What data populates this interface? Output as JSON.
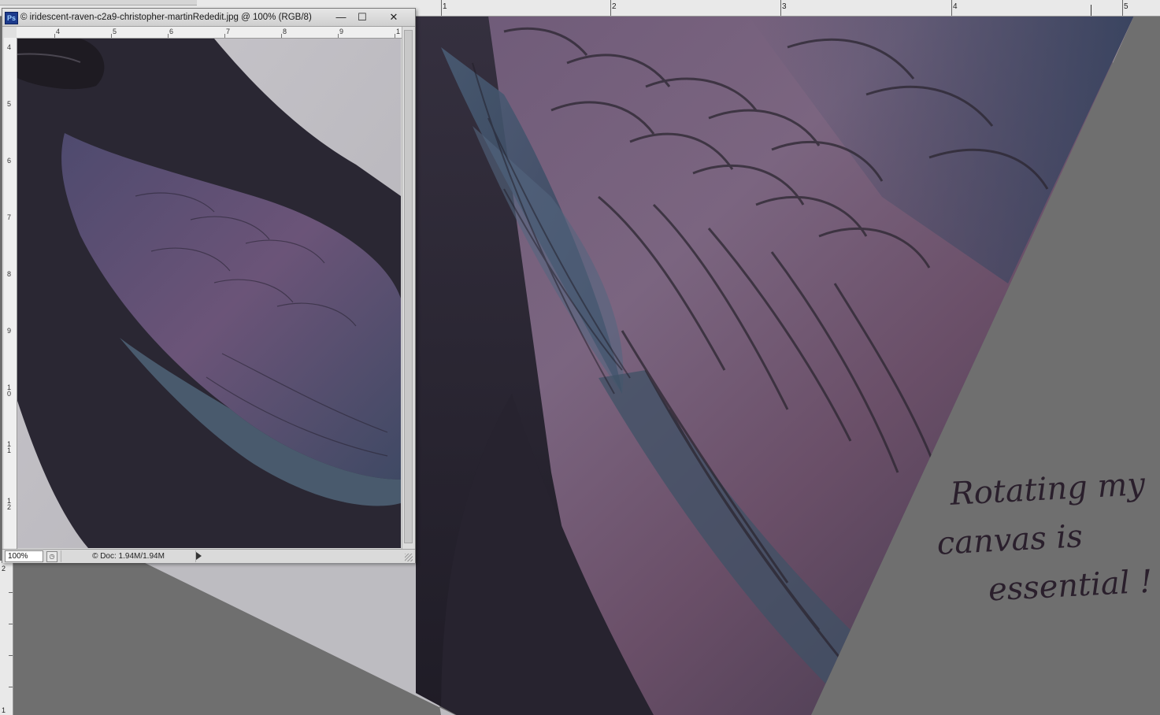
{
  "window": {
    "app_icon": "Ps",
    "title": "© iridescent-raven-c2a9-christopher-martinRededit.jpg @ 100% (RGB/8)",
    "minimize_glyph": "—",
    "maximize_glyph": "☐",
    "close_glyph": "✕"
  },
  "top_ruler": {
    "labels": [
      "1",
      "2",
      "3",
      "4",
      "5"
    ]
  },
  "left_ruler": {
    "labels": [
      "2",
      "1"
    ]
  },
  "doc_rulers": {
    "top_labels": [
      "4",
      "5",
      "6",
      "7",
      "8",
      "9",
      "1"
    ],
    "left_labels": [
      "4",
      "5",
      "6",
      "7",
      "8",
      "9",
      "1 0",
      "1 1",
      "1 2"
    ]
  },
  "status": {
    "zoom": "100%",
    "doc_size": "© Doc: 1.94M/1.94M"
  },
  "annotation": {
    "line1": "Rotating my",
    "line2": "canvas is",
    "line3": "essential !"
  },
  "colors": {
    "workspace": "#6f6f6f",
    "feather_purple": "#7a6580",
    "feather_blue": "#3d4d68",
    "feather_dark": "#2b2733",
    "background_light": "#c3c2c6"
  },
  "icons": {
    "app": "photoshop-icon",
    "status_menu": "triangle-right-icon",
    "status_button": "document-icon"
  }
}
